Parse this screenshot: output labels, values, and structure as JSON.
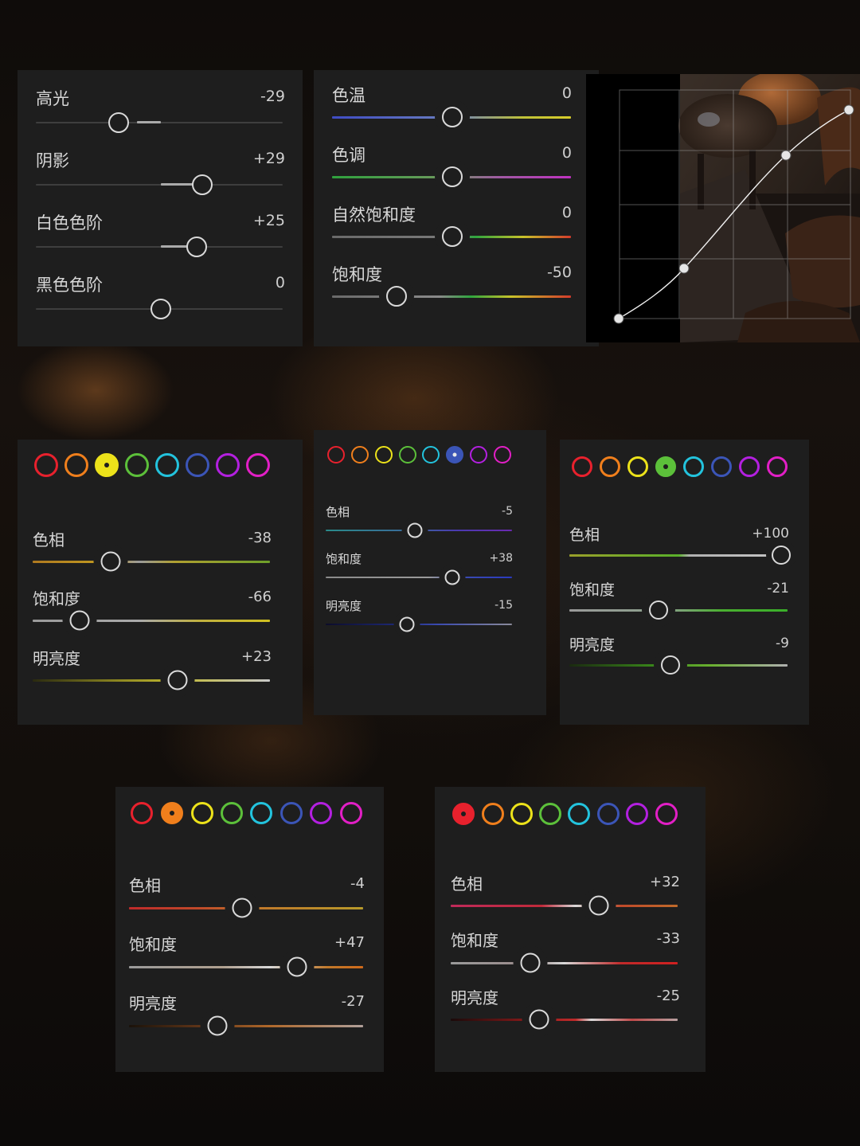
{
  "colors": {
    "panel_bg": "#1e1e1e",
    "swatches": [
      "#e8212d",
      "#f07f1c",
      "#ece21a",
      "#5cc03a",
      "#23c3dd",
      "#3b55b7",
      "#b320e0",
      "#e21fc6"
    ]
  },
  "basic_panel": {
    "rows": [
      {
        "label": "高光",
        "value": "-29",
        "level": -29
      },
      {
        "label": "阴影",
        "value": "+29",
        "level": 29
      },
      {
        "label": "白色色阶",
        "value": "+25",
        "level": 25
      },
      {
        "label": "黑色色阶",
        "value": "0",
        "level": 0
      }
    ]
  },
  "white_balance_panel": {
    "rows": [
      {
        "label": "色温",
        "value": "0",
        "level": 0
      },
      {
        "label": "色调",
        "value": "0",
        "level": 0
      },
      {
        "label": "自然饱和度",
        "value": "0",
        "level": 0
      },
      {
        "label": "饱和度",
        "value": "-50",
        "level": -50
      }
    ]
  },
  "curve_panel": {
    "icon": "tone-curve-graph",
    "points": [
      [
        0,
        0
      ],
      [
        0.3,
        0.2
      ],
      [
        0.7,
        0.7
      ],
      [
        1.0,
        0.93
      ]
    ]
  },
  "hsl_panels": [
    {
      "id": "yellow",
      "selected_index": 2,
      "rows": [
        {
          "label": "色相",
          "value": "-38",
          "level": -38
        },
        {
          "label": "饱和度",
          "value": "-66",
          "level": -66
        },
        {
          "label": "明亮度",
          "value": "+23",
          "level": 23
        }
      ]
    },
    {
      "id": "blue",
      "selected_index": 5,
      "rows": [
        {
          "label": "色相",
          "value": "-5",
          "level": -5
        },
        {
          "label": "饱和度",
          "value": "+38",
          "level": 38
        },
        {
          "label": "明亮度",
          "value": "-15",
          "level": -15
        }
      ]
    },
    {
      "id": "green",
      "selected_index": 3,
      "rows": [
        {
          "label": "色相",
          "value": "+100",
          "level": 100
        },
        {
          "label": "饱和度",
          "value": "-21",
          "level": -21
        },
        {
          "label": "明亮度",
          "value": "-9",
          "level": -9
        }
      ]
    },
    {
      "id": "orange",
      "selected_index": 1,
      "rows": [
        {
          "label": "色相",
          "value": "-4",
          "level": -4
        },
        {
          "label": "饱和度",
          "value": "+47",
          "level": 47
        },
        {
          "label": "明亮度",
          "value": "-27",
          "level": -27
        }
      ]
    },
    {
      "id": "red",
      "selected_index": 0,
      "rows": [
        {
          "label": "色相",
          "value": "+32",
          "level": 32
        },
        {
          "label": "饱和度",
          "value": "-33",
          "level": -33
        },
        {
          "label": "明亮度",
          "value": "-25",
          "level": -25
        }
      ]
    }
  ]
}
